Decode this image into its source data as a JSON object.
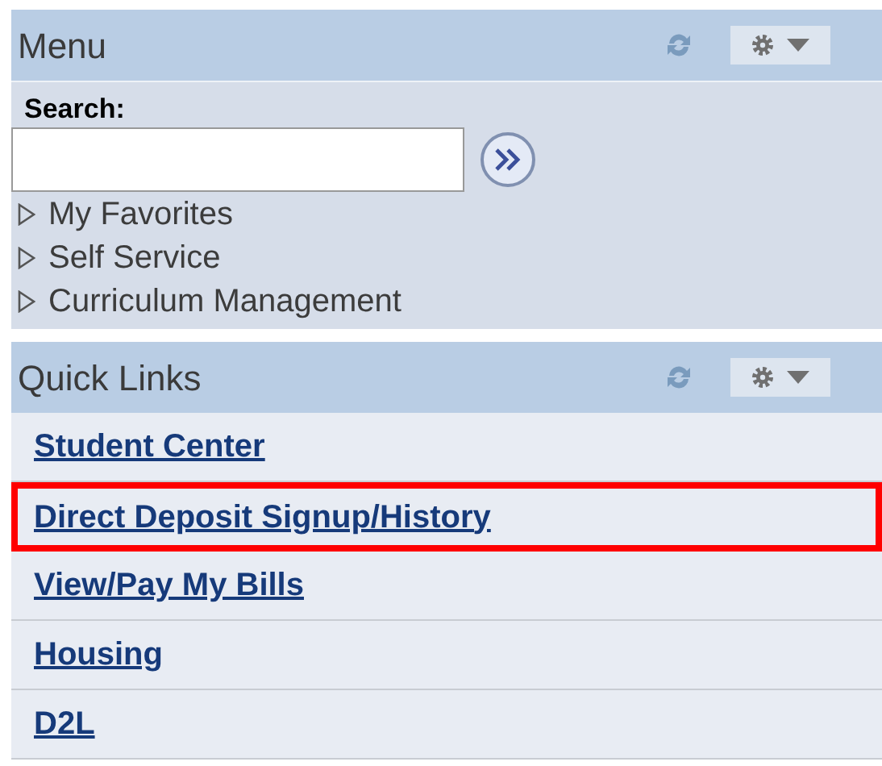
{
  "menu": {
    "title": "Menu",
    "search_label": "Search:",
    "items": [
      {
        "label": "My Favorites",
        "expanded": false
      },
      {
        "label": "Self Service",
        "expanded": false
      },
      {
        "label": "Curriculum Management",
        "expanded": false
      }
    ]
  },
  "quick_links": {
    "title": "Quick Links",
    "links": [
      {
        "label": "Student Center",
        "highlighted": false
      },
      {
        "label": "Direct Deposit Signup/History",
        "highlighted": true
      },
      {
        "label": "View/Pay My Bills",
        "highlighted": false
      },
      {
        "label": "Housing",
        "highlighted": false
      },
      {
        "label": "D2L",
        "highlighted": false
      }
    ]
  }
}
